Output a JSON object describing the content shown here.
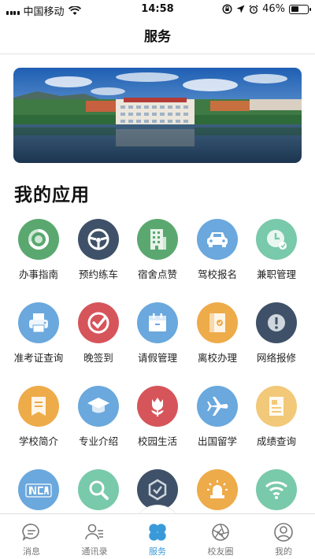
{
  "status_bar": {
    "carrier": "中国移动",
    "time": "14:58",
    "battery_percent": "46%",
    "battery_level": 0.46
  },
  "header": {
    "title": "服务"
  },
  "section": {
    "title": "我的应用"
  },
  "apps": [
    {
      "label": "办事指南",
      "icon": "progress-ring-icon",
      "color": "#5aa86f"
    },
    {
      "label": "预约练车",
      "icon": "steering-wheel-icon",
      "color": "#3f5168"
    },
    {
      "label": "宿舍点赞",
      "icon": "building-icon",
      "color": "#5aa86f"
    },
    {
      "label": "驾校报名",
      "icon": "car-icon",
      "color": "#6aa8dd"
    },
    {
      "label": "兼职管理",
      "icon": "clock-icon",
      "color": "#79c9ab"
    },
    {
      "label": "准考证查询",
      "icon": "printer-icon",
      "color": "#6aa8dd"
    },
    {
      "label": "晚签到",
      "icon": "checkmark-icon",
      "color": "#d6555a"
    },
    {
      "label": "请假管理",
      "icon": "calendar-icon",
      "color": "#6aa8dd"
    },
    {
      "label": "离校办理",
      "icon": "book-check-icon",
      "color": "#eeab4a"
    },
    {
      "label": "网络报修",
      "icon": "alert-globe-icon",
      "color": "#3f5168"
    },
    {
      "label": "学校简介",
      "icon": "document-icon",
      "color": "#eeab4a"
    },
    {
      "label": "专业介绍",
      "icon": "graduation-cap-icon",
      "color": "#6aa8dd"
    },
    {
      "label": "校园生活",
      "icon": "tulip-icon",
      "color": "#d6555a"
    },
    {
      "label": "出国留学",
      "icon": "airplane-icon",
      "color": "#6aa8dd"
    },
    {
      "label": "成绩查询",
      "icon": "report-icon",
      "color": "#f2c879"
    },
    {
      "label": "",
      "icon": "school-logo-icon",
      "color": "#6aa8dd"
    },
    {
      "label": "",
      "icon": "magnifier-icon",
      "color": "#79c9ab"
    },
    {
      "label": "",
      "icon": "hexagon-check-icon",
      "color": "#3f5168"
    },
    {
      "label": "",
      "icon": "siren-icon",
      "color": "#eeab4a"
    },
    {
      "label": "",
      "icon": "wifi-icon",
      "color": "#79c9ab"
    }
  ],
  "tabbar": {
    "tabs": [
      {
        "label": "消息",
        "icon": "chat-bubble-icon"
      },
      {
        "label": "通讯录",
        "icon": "contacts-icon"
      },
      {
        "label": "服务",
        "icon": "clover-icon",
        "active": true
      },
      {
        "label": "校友圈",
        "icon": "aperture-icon"
      },
      {
        "label": "我的",
        "icon": "user-icon"
      }
    ],
    "active_color": "#3a9ad9"
  }
}
